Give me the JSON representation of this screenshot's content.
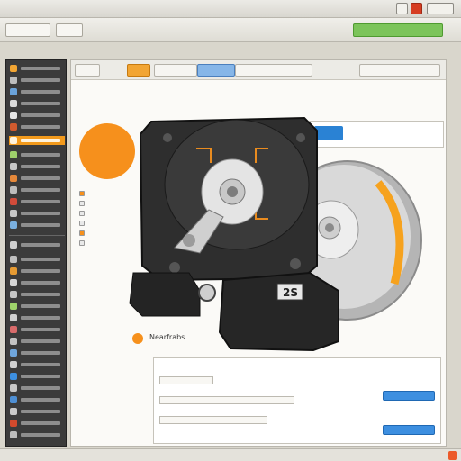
{
  "menubar": {
    "items": [
      "",
      "",
      "",
      "",
      "",
      "",
      "",
      "",
      "",
      ""
    ]
  },
  "toolbar": {
    "chips": [
      "",
      "",
      "",
      "",
      ""
    ],
    "green_button": ""
  },
  "content": {
    "tabs": [
      "",
      "",
      "",
      "",
      "",
      ""
    ]
  },
  "info_panel": {
    "title": "",
    "subtitle": ""
  },
  "caption": {
    "text": "Nearfrabs",
    "right_text": ""
  },
  "drive_label": "2S",
  "legend": [
    "",
    "",
    "",
    "",
    "",
    ""
  ],
  "form": {
    "rows": [
      "",
      "",
      "",
      "",
      "",
      ""
    ],
    "button_1": "",
    "button_2": ""
  },
  "status": {
    "items": [
      "",
      "",
      "",
      "",
      "",
      "",
      ""
    ]
  },
  "colors": {
    "accent": "#f29a1c",
    "sidebar": "#3b3b3b",
    "blue": "#2a82d4",
    "green": "#7cc45a"
  }
}
